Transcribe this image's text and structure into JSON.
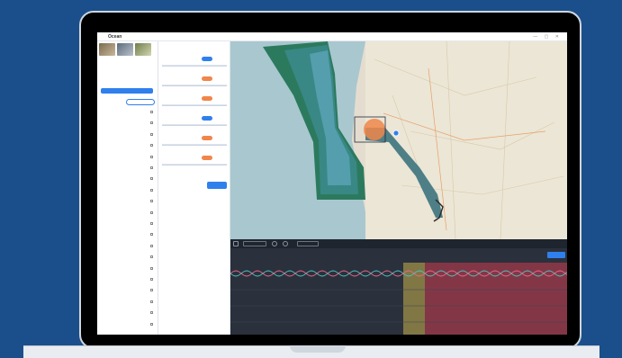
{
  "app": {
    "title": "Ocean",
    "window_controls": "— ▢ ✕"
  },
  "left_panel": {
    "heading": "",
    "button_label": "",
    "filter_label": "",
    "filter_pill_label": "",
    "layers": [
      {
        "label": "",
        "type": "section"
      },
      {
        "label": "",
        "type": "item"
      },
      {
        "label": "",
        "type": "item"
      },
      {
        "label": "",
        "type": "item"
      },
      {
        "label": "",
        "type": "section"
      },
      {
        "label": "",
        "type": "item"
      },
      {
        "label": "",
        "type": "item"
      },
      {
        "label": "",
        "type": "item"
      },
      {
        "label": "",
        "type": "item"
      },
      {
        "label": "",
        "type": "item"
      },
      {
        "label": "",
        "type": "item"
      },
      {
        "label": "",
        "type": "item"
      },
      {
        "label": "",
        "type": "section"
      },
      {
        "label": "",
        "type": "item"
      },
      {
        "label": "",
        "type": "item"
      },
      {
        "label": "",
        "type": "item"
      },
      {
        "label": "",
        "type": "item"
      },
      {
        "label": "",
        "type": "item"
      },
      {
        "label": "",
        "type": "item"
      },
      {
        "label": "",
        "type": "item"
      }
    ]
  },
  "filter_panel": {
    "title": "",
    "filters": [
      {
        "label": "",
        "badge_color": "#2f80ed"
      },
      {
        "label": "",
        "badge_color": "#f0864a"
      },
      {
        "label": "",
        "badge_color": "#f0864a"
      },
      {
        "label": "",
        "badge_color": "#2f80ed"
      },
      {
        "label": "",
        "badge_color": "#f0864a"
      },
      {
        "label": "",
        "badge_color": "#f0864a"
      }
    ],
    "cancel_label": "",
    "apply_label": ""
  },
  "timeline": {
    "tabs": [
      "",
      "",
      "",
      "",
      ""
    ],
    "action_label": "",
    "date_from": "",
    "date_to": ""
  },
  "colors": {
    "brand_blue": "#2f80ed",
    "background": "#1b4f8c",
    "map_sea": "#4b8a8a",
    "zone_teal": "#2c7a5e",
    "highlight_orange": "#f0864a",
    "timeline_red": "#a23a4a",
    "timeline_yellow": "#c9b04a"
  }
}
